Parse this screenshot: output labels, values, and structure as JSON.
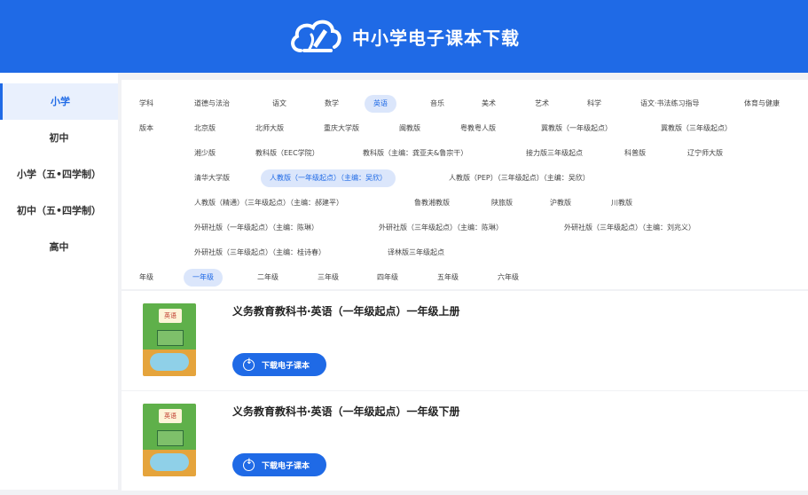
{
  "header": {
    "title": "中小学电子课本下载"
  },
  "sidebar": {
    "items": [
      "小学",
      "初中",
      "小学（五•四学制）",
      "初中（五•四学制）",
      "高中"
    ],
    "active": 0
  },
  "filters": {
    "subject_label": "学科",
    "subjects": [
      "道德与法治",
      "语文",
      "数学",
      "英语",
      "音乐",
      "美术",
      "艺术",
      "科学",
      "语文·书法练习指导",
      "体育与健康"
    ],
    "edition_label": "版本",
    "editions": [
      "北京版",
      "北师大版",
      "重庆大学版",
      "闽教版",
      "粤教粤人版",
      "冀教版（一年级起点）",
      "冀教版（三年级起点）",
      "湘少版",
      "教科版（EEC学院）",
      "教科版（主编：龚亚夫&鲁宗干）",
      "接力版三年级起点",
      "科普版",
      "辽宁师大版",
      "清华大学版",
      "人教版（一年级起点）（主编：吴欣）",
      "人教版（PEP）（三年级起点）（主编：吴欣）",
      "人教版（精通）（三年级起点）（主编：郝建平）",
      "鲁教湘教版",
      "陕旅版",
      "沪教版",
      "川教版",
      "外研社版（一年级起点）（主编：陈琳）",
      "外研社版（三年级起点）（主编：陈琳）",
      "外研社版（三年级起点）（主编：刘兆义）",
      "外研社版（三年级起点）（主编：桂诗春）",
      "译林版三年级起点"
    ],
    "grade_label": "年级",
    "grades": [
      "一年级",
      "二年级",
      "三年级",
      "四年级",
      "五年级",
      "六年级"
    ]
  },
  "books": [
    {
      "title": "义务教育教科书·英语（一年级起点）一年级上册",
      "button": "下载电子课本",
      "cover_text": "英语"
    },
    {
      "title": "义务教育教科书·英语（一年级起点）一年级下册",
      "button": "下载电子课本",
      "cover_text": "英语"
    }
  ],
  "colors": {
    "brand": "#1f6ae6",
    "active_chip_bg": "#dbe6fb"
  },
  "icons": {
    "logo": "cloud-pen-logo-icon",
    "download": "download-circle-icon"
  }
}
